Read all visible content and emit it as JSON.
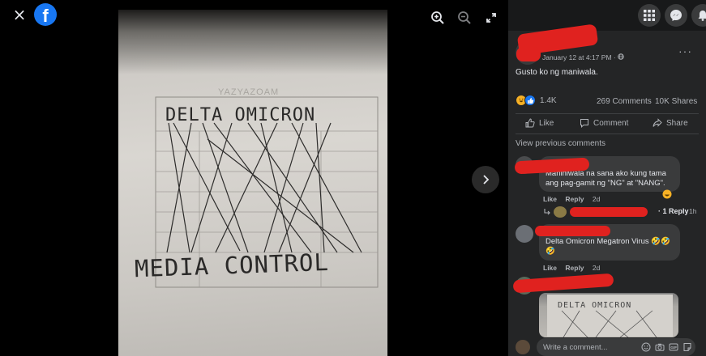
{
  "viewer": {
    "close_icon": "×",
    "logo_letter": "f",
    "icons": [
      "close-icon",
      "facebook-logo",
      "zoom-in-icon",
      "zoom-out-icon",
      "fullscreen-icon",
      "chevron-right-icon"
    ],
    "photo": {
      "top_text": "DELTA OMICRON",
      "bottom_text": "MEDIA CONTROL",
      "faint_header": "YAZYAZOAM"
    }
  },
  "post": {
    "date": "January 12 at 4:17 PM · ",
    "privacy_icon": "globe-icon",
    "more": "···",
    "text": "Gusto ko ng maniwala.",
    "reaction_count": "1.4K",
    "comments": "269 Comments",
    "shares": "10K Shares",
    "actions": {
      "like": "Like",
      "comment": "Comment",
      "share": "Share"
    },
    "view_previous": "View previous comments"
  },
  "comments": [
    {
      "text": "Maniniwala na sana ako kung tama ang pag-gamit ng \"NG\" at \"NANG\".",
      "like": "Like",
      "reply": "Reply",
      "time": "2d",
      "replies_label": "· 1 Reply",
      "replies_time": "1h"
    },
    {
      "text": "Delta Omicron Megatron Virus 🤣🤣🤣",
      "like": "Like",
      "reply": "Reply",
      "time": "2d"
    },
    {
      "image_text": "DELTA OMICRON"
    }
  ],
  "composer": {
    "placeholder": "Write a comment..."
  },
  "colors": {
    "facebook_blue": "#1877f2",
    "panel_bg": "#242526",
    "redaction": "#e0221f"
  }
}
